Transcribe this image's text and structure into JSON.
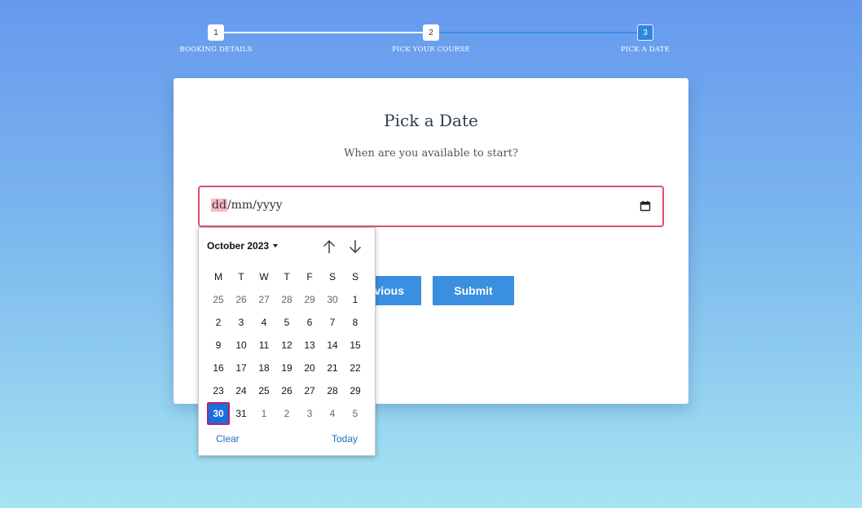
{
  "stepper": {
    "steps": [
      {
        "number": "1",
        "label": "BOOKING DETAILS",
        "state": "done"
      },
      {
        "number": "2",
        "label": "PICK YOUR COURSE",
        "state": "done"
      },
      {
        "number": "3",
        "label": "PICK A DATE",
        "state": "active"
      }
    ]
  },
  "card": {
    "title": "Pick a Date",
    "subtitle": "When are you available to start?",
    "date_input": {
      "day": "dd",
      "sep": "/",
      "month": "mm",
      "year": "yyyy",
      "icon": "calendar-icon"
    },
    "buttons": {
      "previous": "Previous",
      "previous_visible": "vious",
      "submit": "Submit"
    }
  },
  "datepicker": {
    "month_label": "October 2023",
    "weekdays": [
      "M",
      "T",
      "W",
      "T",
      "F",
      "S",
      "S"
    ],
    "weeks": [
      [
        {
          "d": "25",
          "o": true
        },
        {
          "d": "26",
          "o": true
        },
        {
          "d": "27",
          "o": true
        },
        {
          "d": "28",
          "o": true
        },
        {
          "d": "29",
          "o": true
        },
        {
          "d": "30",
          "o": true
        },
        {
          "d": "1",
          "o": false
        }
      ],
      [
        {
          "d": "2",
          "o": false
        },
        {
          "d": "3",
          "o": false
        },
        {
          "d": "4",
          "o": false
        },
        {
          "d": "5",
          "o": false
        },
        {
          "d": "6",
          "o": false
        },
        {
          "d": "7",
          "o": false
        },
        {
          "d": "8",
          "o": false
        }
      ],
      [
        {
          "d": "9",
          "o": false
        },
        {
          "d": "10",
          "o": false
        },
        {
          "d": "11",
          "o": false
        },
        {
          "d": "12",
          "o": false
        },
        {
          "d": "13",
          "o": false
        },
        {
          "d": "14",
          "o": false
        },
        {
          "d": "15",
          "o": false
        }
      ],
      [
        {
          "d": "16",
          "o": false
        },
        {
          "d": "17",
          "o": false
        },
        {
          "d": "18",
          "o": false
        },
        {
          "d": "19",
          "o": false
        },
        {
          "d": "20",
          "o": false
        },
        {
          "d": "21",
          "o": false
        },
        {
          "d": "22",
          "o": false
        }
      ],
      [
        {
          "d": "23",
          "o": false
        },
        {
          "d": "24",
          "o": false
        },
        {
          "d": "25",
          "o": false
        },
        {
          "d": "26",
          "o": false
        },
        {
          "d": "27",
          "o": false
        },
        {
          "d": "28",
          "o": false
        },
        {
          "d": "29",
          "o": false
        }
      ],
      [
        {
          "d": "30",
          "o": false,
          "selected": true
        },
        {
          "d": "31",
          "o": false
        },
        {
          "d": "1",
          "o": true
        },
        {
          "d": "2",
          "o": true
        },
        {
          "d": "3",
          "o": true
        },
        {
          "d": "4",
          "o": true
        },
        {
          "d": "5",
          "o": true
        }
      ]
    ],
    "clear_label": "Clear",
    "today_label": "Today"
  },
  "colors": {
    "accent": "#3a8fe0",
    "invalid_border": "#d9536b",
    "selected_day": "#1a6ee0"
  }
}
